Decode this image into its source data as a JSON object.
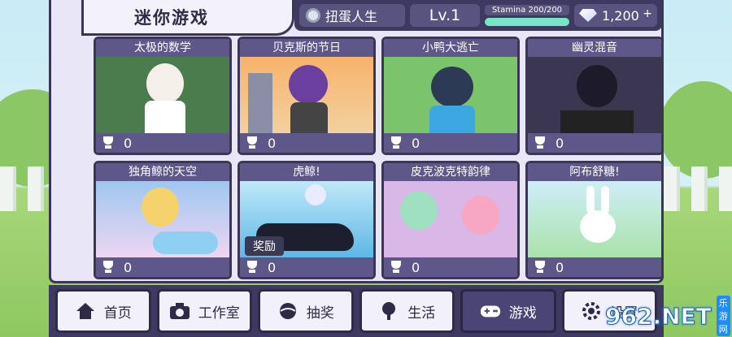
{
  "header": {
    "title": "迷你游戏"
  },
  "topbar": {
    "game_name": "扭蛋人生",
    "level": "Lv.1",
    "stamina_label": "Stamina 200/200",
    "stamina_fraction": 1.0,
    "gems": "1,200",
    "plus": "+"
  },
  "games": [
    {
      "title": "太极的数学",
      "score": "0"
    },
    {
      "title": "贝克斯的节日",
      "score": "0"
    },
    {
      "title": "小鸭大逃亡",
      "score": "0"
    },
    {
      "title": "幽灵混音",
      "score": "0"
    },
    {
      "title": "独角鲸的天空",
      "score": "0"
    },
    {
      "title": "虎鲸!",
      "score": "0",
      "badge": "奖励"
    },
    {
      "title": "皮克波克特韵律",
      "score": "0"
    },
    {
      "title": "阿布舒糖!",
      "score": "0"
    }
  ],
  "nav": {
    "items": [
      {
        "label": "首页",
        "icon": "home-icon"
      },
      {
        "label": "工作室",
        "icon": "camera-icon"
      },
      {
        "label": "抽奖",
        "icon": "gacha-icon"
      },
      {
        "label": "生活",
        "icon": "tree-icon"
      },
      {
        "label": "游戏",
        "icon": "gamepad-icon"
      },
      {
        "label": "设置",
        "icon": "gear-icon"
      }
    ]
  },
  "watermark": {
    "big": "962.NET",
    "small": "乐游网"
  },
  "colors": {
    "accent": "#5e5789",
    "panel": "#3e3960",
    "stamina": "#76e6c9"
  }
}
